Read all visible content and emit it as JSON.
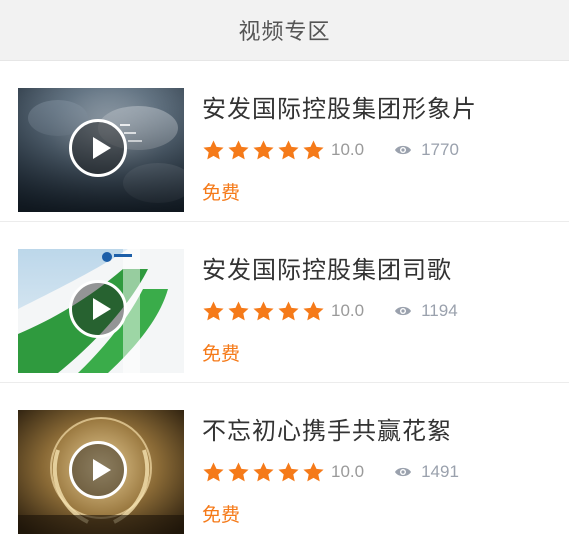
{
  "header": {
    "title": "视频专区"
  },
  "colors": {
    "star": "#f57a19",
    "price": "#f57a19",
    "eye": "#9aa1ad"
  },
  "videos": [
    {
      "title": "安发国际控股集团形象片",
      "stars": 5,
      "rating": "10.0",
      "views": "1770",
      "price": "免费",
      "thumb_icon": "play-icon"
    },
    {
      "title": "安发国际控股集团司歌",
      "stars": 5,
      "rating": "10.0",
      "views": "1194",
      "price": "免费",
      "thumb_icon": "play-icon"
    },
    {
      "title": "不忘初心携手共赢花絮",
      "stars": 5,
      "rating": "10.0",
      "views": "1491",
      "price": "免费",
      "thumb_icon": "play-icon"
    }
  ]
}
